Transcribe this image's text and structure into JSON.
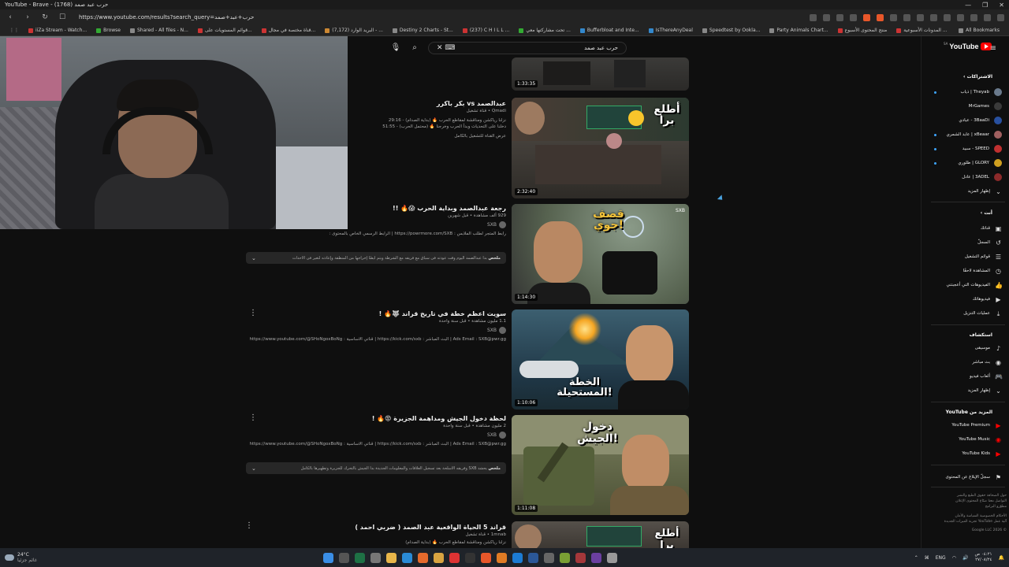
{
  "browser": {
    "window_title": "YouTube - Brave - (1768) حرب عبد صمد",
    "url": "https://www.youtube.com/results?search_query=حرب+عبد+صمد",
    "bookmarks": [
      "iiZa Stream - Watch...",
      "Browse",
      "Shared - All files - N...",
      "قوائم المستويات على...",
      "قناة مختصة في مجال...",
      "(7,172) البريد الوارد - ...",
      "Destiny 2 Charts - St...",
      "(237) C H I L L ...",
      "تحت مشاركتها معي ...",
      "Bufferbloat and Inte...",
      "IsThereAnyDeal",
      "Speedtest by Ookla...",
      "Party Animals Chart...",
      "منتج المحتوى الأسبوع",
      "المدونات الأسبوعية ..."
    ],
    "all_bookmarks": "All Bookmarks"
  },
  "search": {
    "query": "حرب عبد صمد"
  },
  "results": [
    {
      "title": "",
      "meta": "",
      "duration": "1:33:35",
      "thumb_text": ""
    },
    {
      "title": "عبدالصمد vs بكر باكرر",
      "meta": "Qmadi • قناة تشغيل",
      "desc1": "نزلنا رياكشن ومناقشة لمقاطع الحرب 🔥 (بداية الصدام) - 29:16",
      "desc2": "دخلنا على التحديات وبدأ الحرب وخرجنا 🔥 (محتمل الحرب) - 51:55",
      "desc3": "عرض القناة للتشغيل بالكامل",
      "duration": "2:32:40",
      "thumb_text": "أطلع برا"
    },
    {
      "title": "رجعة عبدالصمد وبداية الحرب 😱🔥 !!",
      "meta": "929 ألف مشاهدة • قبل شهرين",
      "channel": "SXB",
      "desc": "رابط المتجر لطلب الملابس : https://powrmore.com/SXB | الرابط الرسمي الخاص بالمحتوى :",
      "summary_label": "ملخص",
      "summary": "بدأ عبدالصمد اليوم وقت عودته فى سباق مع فريقه مع الشرطة ويتم أيضًا إخراجها من المنطقة وإعادته لتغير فى الأحداث",
      "duration": "1:14:30",
      "thumb_text": "قصف جوي!",
      "badge": "SXB"
    },
    {
      "title": "سويت اعظم خطة في تاريخ قراند 🐺🔥 !",
      "meta": "1.1 مليون مشاهدة • قبل سنة واحدة",
      "channel": "SXB",
      "desc": "Ads Email : SXB@pwr.gg | البث المباشر : https://kick.com/sxb | قناتي الاساسية : https://www.youtube.com/@SHoNgoxBoNg",
      "duration": "1:10:06",
      "thumb_text": "الخطة المستحيلة!"
    },
    {
      "title": "لحظة دخول الجيش ومداهمة الجزيرة 😡🔥 !",
      "meta": "2 مليون مشاهدة • قبل سنة واحدة",
      "channel": "SXB",
      "desc": "Ads Email : SXB@pwr.gg | البث المباشر : https://kick.com/sxb | قناتي الاساسية : https://www.youtube.com/@SHoNgoxBoNg",
      "summary_label": "ملخص",
      "summary": "يحشد SXB وفريقه الأسلحة بعد تسجيل العلاقات والمعلومات الجديدة بدأ الجيش بالتحرك للجزيرة وتطهيرها بالكامل",
      "duration": "1:11:08",
      "thumb_text": "دخول الجيش!"
    },
    {
      "title": "قراند 5 الحياة الواقعية عبد الصمد ( ضربي احمد )",
      "meta": "1mnab • قناة تشغيل",
      "desc": "نزلنا رياكشن ومناقشة لمقاطع الحرب 🔥 (بداية الصدام)",
      "thumb_text": "أطلع برا"
    }
  ],
  "sidebar": {
    "logo": "YouTube",
    "country": "SA",
    "subs_header": "الاشتراكات",
    "subscriptions": [
      {
        "name": "Theyab | ذياب",
        "dot": true
      },
      {
        "name": "MrGames",
        "dot": false
      },
      {
        "name": "3BaaDi - عبادي",
        "dot": false
      },
      {
        "name": "xBeaar | عابد الشمري",
        "dot": true
      },
      {
        "name": "SPEED - سبيد",
        "dot": true
      },
      {
        "name": "GLORY | طلوري",
        "dot": true
      },
      {
        "name": "3ADEL | عادل",
        "dot": false
      }
    ],
    "show_more": "إظهار المزيد",
    "you_header": "أنت",
    "you_items": [
      {
        "label": "قناتك",
        "icon": "channel-icon"
      },
      {
        "label": "السجلّ",
        "icon": "history-icon"
      },
      {
        "label": "قوائم التشغيل",
        "icon": "playlist-icon"
      },
      {
        "label": "المشاهدة لاحقًا",
        "icon": "clock-icon"
      },
      {
        "label": "الفيديوهات التي أعجبتني",
        "icon": "like-icon"
      },
      {
        "label": "فيديوهاتك",
        "icon": "video-icon"
      },
      {
        "label": "عمليات التنزيل",
        "icon": "download-icon"
      }
    ],
    "explore_header": "استكشاف",
    "explore_items": [
      {
        "label": "موسيقى",
        "icon": "music-icon"
      },
      {
        "label": "بث مباشر",
        "icon": "live-icon"
      },
      {
        "label": "ألعاب فيديو",
        "icon": "gaming-icon"
      },
      {
        "label": "إظهار المزيد",
        "icon": "chevron-down-icon"
      }
    ],
    "more_header": "المزيد من YouTube",
    "more_items": [
      {
        "label": "YouTube Premium"
      },
      {
        "label": "YouTube Music"
      },
      {
        "label": "YouTube Kids"
      }
    ],
    "report_history": "سجلّ الإبلاغ عن المحتوى",
    "footer1": "حول  الصحافة  حقوق الطبع والنشر",
    "footer2": "التواصل معنا  صنّاع المحتوى  الإعلان",
    "footer3": "مطوّرو البرامج",
    "footer4": "الأحكام  الخصوصية  السياسة والأمان",
    "footer5": "آلية عمل YouTube  تجربة الميزات الجديدة",
    "copyright": "© 2026 Google LLC"
  },
  "taskbar": {
    "temp": "24°C",
    "weather_desc": "غائم جزئيا",
    "lang": "ENG",
    "time": "٠٤:٢١ ص",
    "date": "٢٧/٠٨/٢٤"
  },
  "colors": {
    "bg": "#0f0f0f",
    "accent_red": "#ff0000",
    "link_blue": "#3ea6ff"
  }
}
